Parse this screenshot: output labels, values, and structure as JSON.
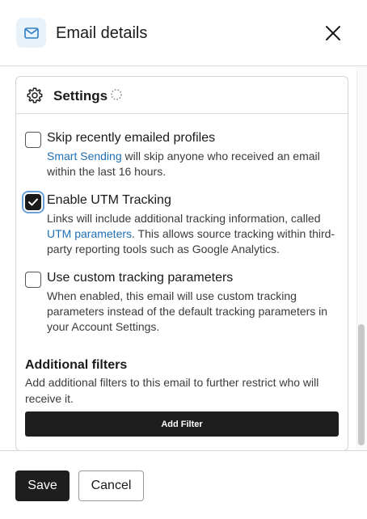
{
  "header": {
    "title": "Email details",
    "icon": "envelope-icon",
    "close_icon": "close-icon"
  },
  "settings": {
    "title": "Settings",
    "icon": "gear-icon",
    "loading_icon": "spinner-icon",
    "options": [
      {
        "label": "Skip recently emailed profiles",
        "checked": false,
        "link_text": "Smart Sending",
        "desc": " will skip anyone who received an email within the last 16 hours."
      },
      {
        "label": "Enable UTM Tracking",
        "checked": true,
        "desc_before": "Links will include additional tracking information, called ",
        "link_text": "UTM parameters",
        "desc_after": ". This allows source tracking within third-party reporting tools such as Google Analytics."
      },
      {
        "label": "Use custom tracking parameters",
        "checked": false,
        "desc": "When enabled, this email will use custom tracking parameters instead of the default tracking parameters in your Account Settings."
      }
    ]
  },
  "filters": {
    "title": "Additional filters",
    "desc": "Add additional filters to this email to further restrict who will receive it.",
    "button_label": "Add Filter"
  },
  "footer": {
    "save_label": "Save",
    "cancel_label": "Cancel"
  },
  "colors": {
    "link": "#1f6fb5",
    "primary_button": "#1e1e1e",
    "icon_bg": "#e7f2fb",
    "icon_accent": "#2f7dc4"
  }
}
